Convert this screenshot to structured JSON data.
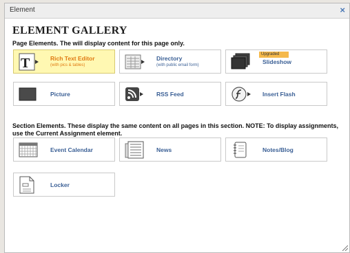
{
  "dialog": {
    "title": "Element",
    "close_glyph": "×"
  },
  "gallery": {
    "heading": "ELEMENT GALLERY",
    "page_section_text": "Page Elements. The will display content for this page only.",
    "section_section_text": "Section Elements. These display the same content on all pages in this section. NOTE: To display assignments, use the Current Assignment element."
  },
  "page_elements": [
    {
      "label": "Rich Text Editor",
      "sub": "(with pics & tables)",
      "icon": "rich-text-icon",
      "highlighted": true
    },
    {
      "label": "Directory",
      "sub": "(with public email form)",
      "icon": "directory-icon"
    },
    {
      "label": "Slideshow",
      "badge": "Upgraded",
      "icon": "slideshow-icon"
    },
    {
      "label": "Picture",
      "icon": "picture-icon"
    },
    {
      "label": "RSS Feed",
      "icon": "rss-feed-icon"
    },
    {
      "label": "Insert Flash",
      "icon": "flash-icon"
    }
  ],
  "section_elements": [
    {
      "label": "Event Calendar",
      "icon": "calendar-icon"
    },
    {
      "label": "News",
      "icon": "news-icon"
    },
    {
      "label": "Notes/Blog",
      "icon": "notes-blog-icon"
    },
    {
      "label": "Locker",
      "icon": "locker-icon"
    }
  ],
  "colors": {
    "link_blue": "#3a5f95",
    "highlight_bg": "#fff8b2",
    "highlight_text": "#e07a12",
    "badge_bg": "#f5b94b",
    "close_blue": "#4a78b5"
  }
}
